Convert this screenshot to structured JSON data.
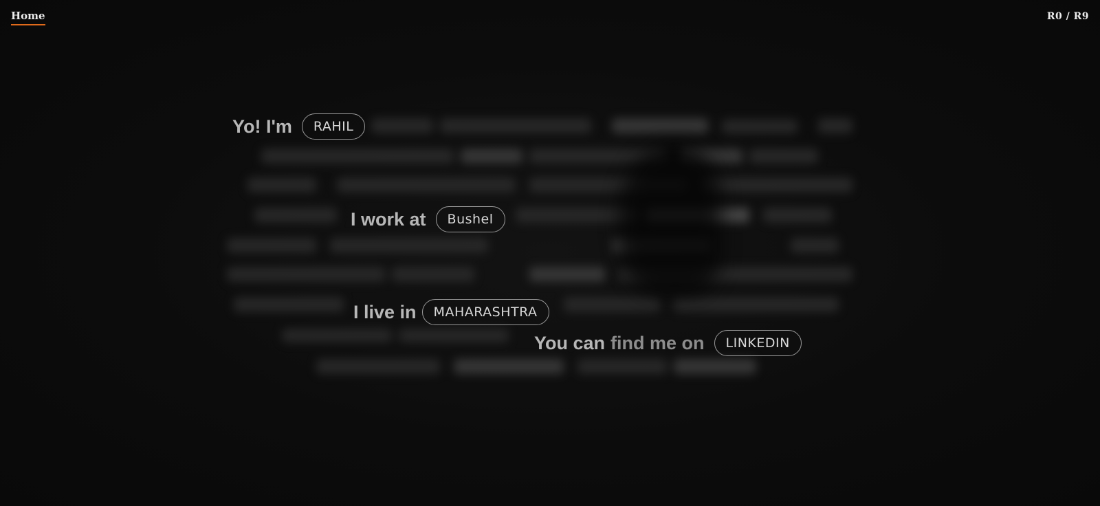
{
  "nav": {
    "home_label": "Home",
    "right_label": "R0 / R9"
  },
  "intro": {
    "line1_text": "Yo! I'm",
    "line1_tag": "RAHIL",
    "line2_text": "I work at",
    "line2_tag": "Bushel",
    "line3_text": "I live in",
    "line3_tag": "MAHARASHTRA",
    "line4_text_a": "You can",
    "line4_text_b": "find me on",
    "line4_tag": "LINKEDIN"
  },
  "colors": {
    "background": "#0b0b0b",
    "accent": "#e06a1b",
    "text": "#b7b7b7"
  }
}
